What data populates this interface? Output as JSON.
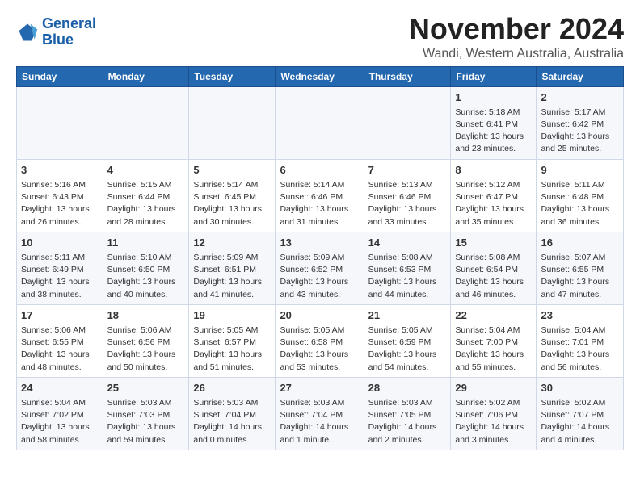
{
  "logo": {
    "line1": "General",
    "line2": "Blue"
  },
  "title": "November 2024",
  "location": "Wandi, Western Australia, Australia",
  "headers": [
    "Sunday",
    "Monday",
    "Tuesday",
    "Wednesday",
    "Thursday",
    "Friday",
    "Saturday"
  ],
  "weeks": [
    [
      {
        "day": "",
        "info": ""
      },
      {
        "day": "",
        "info": ""
      },
      {
        "day": "",
        "info": ""
      },
      {
        "day": "",
        "info": ""
      },
      {
        "day": "",
        "info": ""
      },
      {
        "day": "1",
        "info": "Sunrise: 5:18 AM\nSunset: 6:41 PM\nDaylight: 13 hours\nand 23 minutes."
      },
      {
        "day": "2",
        "info": "Sunrise: 5:17 AM\nSunset: 6:42 PM\nDaylight: 13 hours\nand 25 minutes."
      }
    ],
    [
      {
        "day": "3",
        "info": "Sunrise: 5:16 AM\nSunset: 6:43 PM\nDaylight: 13 hours\nand 26 minutes."
      },
      {
        "day": "4",
        "info": "Sunrise: 5:15 AM\nSunset: 6:44 PM\nDaylight: 13 hours\nand 28 minutes."
      },
      {
        "day": "5",
        "info": "Sunrise: 5:14 AM\nSunset: 6:45 PM\nDaylight: 13 hours\nand 30 minutes."
      },
      {
        "day": "6",
        "info": "Sunrise: 5:14 AM\nSunset: 6:46 PM\nDaylight: 13 hours\nand 31 minutes."
      },
      {
        "day": "7",
        "info": "Sunrise: 5:13 AM\nSunset: 6:46 PM\nDaylight: 13 hours\nand 33 minutes."
      },
      {
        "day": "8",
        "info": "Sunrise: 5:12 AM\nSunset: 6:47 PM\nDaylight: 13 hours\nand 35 minutes."
      },
      {
        "day": "9",
        "info": "Sunrise: 5:11 AM\nSunset: 6:48 PM\nDaylight: 13 hours\nand 36 minutes."
      }
    ],
    [
      {
        "day": "10",
        "info": "Sunrise: 5:11 AM\nSunset: 6:49 PM\nDaylight: 13 hours\nand 38 minutes."
      },
      {
        "day": "11",
        "info": "Sunrise: 5:10 AM\nSunset: 6:50 PM\nDaylight: 13 hours\nand 40 minutes."
      },
      {
        "day": "12",
        "info": "Sunrise: 5:09 AM\nSunset: 6:51 PM\nDaylight: 13 hours\nand 41 minutes."
      },
      {
        "day": "13",
        "info": "Sunrise: 5:09 AM\nSunset: 6:52 PM\nDaylight: 13 hours\nand 43 minutes."
      },
      {
        "day": "14",
        "info": "Sunrise: 5:08 AM\nSunset: 6:53 PM\nDaylight: 13 hours\nand 44 minutes."
      },
      {
        "day": "15",
        "info": "Sunrise: 5:08 AM\nSunset: 6:54 PM\nDaylight: 13 hours\nand 46 minutes."
      },
      {
        "day": "16",
        "info": "Sunrise: 5:07 AM\nSunset: 6:55 PM\nDaylight: 13 hours\nand 47 minutes."
      }
    ],
    [
      {
        "day": "17",
        "info": "Sunrise: 5:06 AM\nSunset: 6:55 PM\nDaylight: 13 hours\nand 48 minutes."
      },
      {
        "day": "18",
        "info": "Sunrise: 5:06 AM\nSunset: 6:56 PM\nDaylight: 13 hours\nand 50 minutes."
      },
      {
        "day": "19",
        "info": "Sunrise: 5:05 AM\nSunset: 6:57 PM\nDaylight: 13 hours\nand 51 minutes."
      },
      {
        "day": "20",
        "info": "Sunrise: 5:05 AM\nSunset: 6:58 PM\nDaylight: 13 hours\nand 53 minutes."
      },
      {
        "day": "21",
        "info": "Sunrise: 5:05 AM\nSunset: 6:59 PM\nDaylight: 13 hours\nand 54 minutes."
      },
      {
        "day": "22",
        "info": "Sunrise: 5:04 AM\nSunset: 7:00 PM\nDaylight: 13 hours\nand 55 minutes."
      },
      {
        "day": "23",
        "info": "Sunrise: 5:04 AM\nSunset: 7:01 PM\nDaylight: 13 hours\nand 56 minutes."
      }
    ],
    [
      {
        "day": "24",
        "info": "Sunrise: 5:04 AM\nSunset: 7:02 PM\nDaylight: 13 hours\nand 58 minutes."
      },
      {
        "day": "25",
        "info": "Sunrise: 5:03 AM\nSunset: 7:03 PM\nDaylight: 13 hours\nand 59 minutes."
      },
      {
        "day": "26",
        "info": "Sunrise: 5:03 AM\nSunset: 7:04 PM\nDaylight: 14 hours\nand 0 minutes."
      },
      {
        "day": "27",
        "info": "Sunrise: 5:03 AM\nSunset: 7:04 PM\nDaylight: 14 hours\nand 1 minute."
      },
      {
        "day": "28",
        "info": "Sunrise: 5:03 AM\nSunset: 7:05 PM\nDaylight: 14 hours\nand 2 minutes."
      },
      {
        "day": "29",
        "info": "Sunrise: 5:02 AM\nSunset: 7:06 PM\nDaylight: 14 hours\nand 3 minutes."
      },
      {
        "day": "30",
        "info": "Sunrise: 5:02 AM\nSunset: 7:07 PM\nDaylight: 14 hours\nand 4 minutes."
      }
    ]
  ]
}
